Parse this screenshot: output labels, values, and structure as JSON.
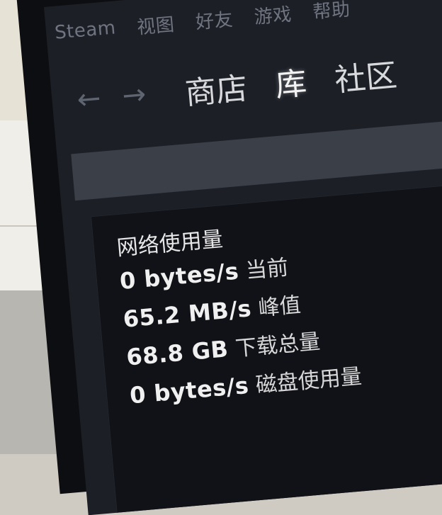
{
  "menu": [
    "Steam",
    "视图",
    "好友",
    "游戏",
    "帮助"
  ],
  "nav": {
    "back_icon": "arrow-left-icon",
    "forward_icon": "arrow-right-icon",
    "tabs": [
      "商店",
      "库",
      "社区"
    ],
    "active_tab": "库"
  },
  "network": {
    "title": "网络使用量",
    "stats": [
      {
        "value": "0 bytes/s",
        "label": "当前"
      },
      {
        "value": "65.2 MB/s",
        "label": "峰值"
      },
      {
        "value": "68.8 GB",
        "label": "下载总量"
      },
      {
        "value": "0 bytes/s",
        "label": "磁盘使用量"
      }
    ]
  }
}
